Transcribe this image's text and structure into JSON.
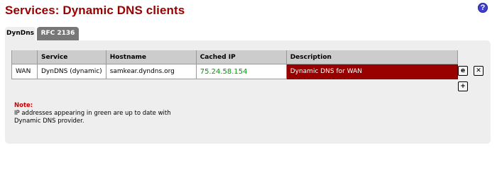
{
  "page": {
    "title": "Services: Dynamic DNS clients",
    "help_glyph": "?"
  },
  "tabs": [
    {
      "label": "DynDns",
      "active": true
    },
    {
      "label": "RFC 2136",
      "active": false
    }
  ],
  "table": {
    "headers": [
      "",
      "Service",
      "Hostname",
      "Cached IP",
      "Description"
    ],
    "rows": [
      {
        "interface": "WAN",
        "service": "DynDNS (dynamic)",
        "hostname": "samkear.dyndns.org",
        "cached_ip": "75.24.58.154",
        "description": "Dynamic DNS for WAN"
      }
    ]
  },
  "actions": {
    "edit_glyph": "e",
    "delete_glyph": "✕",
    "add_glyph": "+"
  },
  "note": {
    "label": "Note:",
    "line1": "IP addresses appearing in green are up to date with",
    "line2": "Dynamic DNS provider."
  },
  "colors": {
    "title": "#990000",
    "ip_uptodate": "#009900",
    "selected_row": "#990000",
    "tab_inactive": "#777777"
  }
}
